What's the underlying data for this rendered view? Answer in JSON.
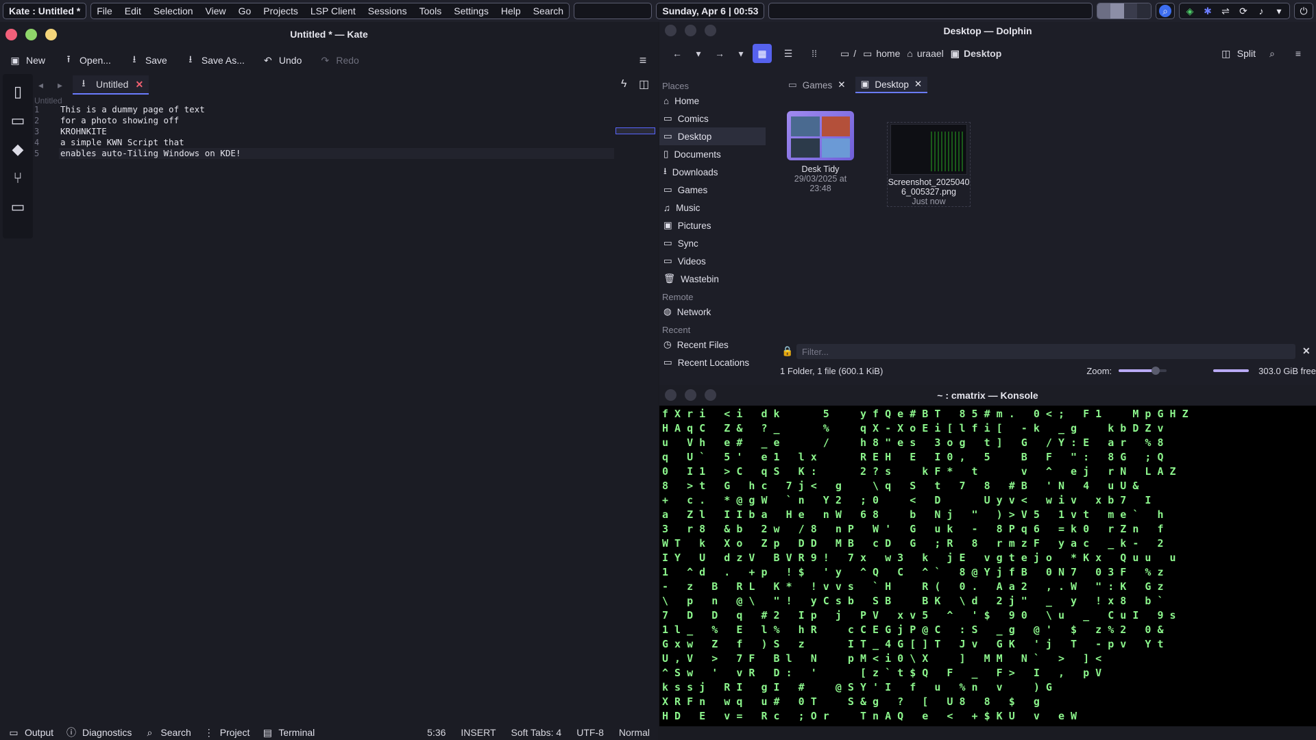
{
  "panel": {
    "window_title": "Kate : Untitled *",
    "menu": [
      "File",
      "Edit",
      "Selection",
      "View",
      "Go",
      "Projects",
      "LSP Client",
      "Sessions",
      "Tools",
      "Settings",
      "Help",
      "Search"
    ],
    "clock": "Sunday, Apr 6 | 00:53"
  },
  "kate": {
    "title": "Untitled * — Kate",
    "toolbar": {
      "new": "New",
      "open": "Open...",
      "save": "Save",
      "save_as": "Save As...",
      "undo": "Undo",
      "redo": "Redo"
    },
    "tab_label": "Untitled",
    "doc_name": "Untitled",
    "line_numbers": [
      "1",
      "2",
      "3",
      "4",
      "5"
    ],
    "lines": [
      "This is a dummy page of text",
      "for a photo showing off",
      "KROHNKITE",
      "a simple KWN Script that",
      "enables auto-Tiling Windows on KDE!"
    ],
    "status": {
      "output": "Output",
      "diagnostics": "Diagnostics",
      "search": "Search",
      "project": "Project",
      "terminal": "Terminal",
      "position": "5:36",
      "mode": "INSERT",
      "tabs": "Soft Tabs: 4",
      "encoding": "UTF-8",
      "style": "Normal"
    }
  },
  "dolphin": {
    "title": "Desktop — Dolphin",
    "crumbs": {
      "root": "/",
      "home": "home",
      "user": "uraael",
      "current": "Desktop"
    },
    "split": "Split",
    "places_header": "Places",
    "places": [
      "Home",
      "Comics",
      "Desktop",
      "Documents",
      "Downloads",
      "Games",
      "Music",
      "Pictures",
      "Sync",
      "Videos",
      "Wastebin"
    ],
    "remote_header": "Remote",
    "remote": [
      "Network"
    ],
    "recent_header": "Recent",
    "recent": [
      "Recent Files",
      "Recent Locations"
    ],
    "tabs": [
      "Games",
      "Desktop"
    ],
    "files": [
      {
        "name": "Desk Tidy",
        "meta": "29/03/2025 at 23:48"
      },
      {
        "name": "Screenshot_20250406_005327.png",
        "meta": "Just now"
      }
    ],
    "filter_placeholder": "Filter...",
    "status_text": "1 Folder, 1 file (600.1 KiB)",
    "zoom_label": "Zoom:",
    "free_space": "303.0 GiB free",
    "colors": {
      "accent": "#5662ee"
    }
  },
  "konsole": {
    "title": "~ : cmatrix — Konsole",
    "rows": [
      "fXri <i dk   5  yfQe#BT 85#m. 0<; F1  MpGHZ",
      "HAqC Z& ?_   %  qX-XoEi[lfi[ -k _g  kbDZv",
      "u Vh e# _e   /  h8\"es 3og t] G /Y:E ar %8",
      "q U` 5' e1 lx   REH E I0, 5  B F \": 8G ;Q",
      "0 I1 >C qS K:   2?s  kF* t   v ^ ej rN LAZ",
      "8 >t G hc 7j< g  \\q S t 7 8 #B 'N 4 uU&",
      "+ c. *@gW `n Y2 ;0  < D   Uyv< wiv xb7 I",
      "a Zl IIba He nW 68  b Nj \" )>V5 1vt me` h",
      "3 r8 &b 2w /8 nP W' G uk - 8Pq6 =k0 rZn f",
      "WT k Xo Zp DD MB cD G ;R 8 rmzF yac _k- 2",
      "IY U dzV BVR9! 7x w3 k jE vgtejo *Kx Quu u",
      "1 ^d . +p !$ 'y ^Q C ^` 8@YjfB 0N7 03F %z",
      "- z B RL K* !vvs `H  R( 0. Aa2 ,.W \":K Gz",
      "\\ p n @\\ \"! yCsb SB  BK \\d 2j\" _ y !x8 b`",
      "7 D D q #2 Ip j PV xv5 ^ '$ 90 \\u _ CuI 9s",
      "1l_ % E l% hR  cCEGjP@C :S _g @' $ z%2 0&",
      "Gxw Z f )S z   IT_4G[]T Jv GK 'j T -pv Yt",
      "U,V > 7F Bl N  pM<i0\\X  ] MM N` > ]<",
      "^Sw ' vR D: '   [z`t$Q F _ F> I , pV",
      "kssj RI gI #  @SY'I f u %n v  )G",
      "XRFn wq u# 0T  S&g ? [ U8 8 $ g",
      "HD E v= Rc ;Or  TnAQ e < +$KU v eW"
    ]
  }
}
